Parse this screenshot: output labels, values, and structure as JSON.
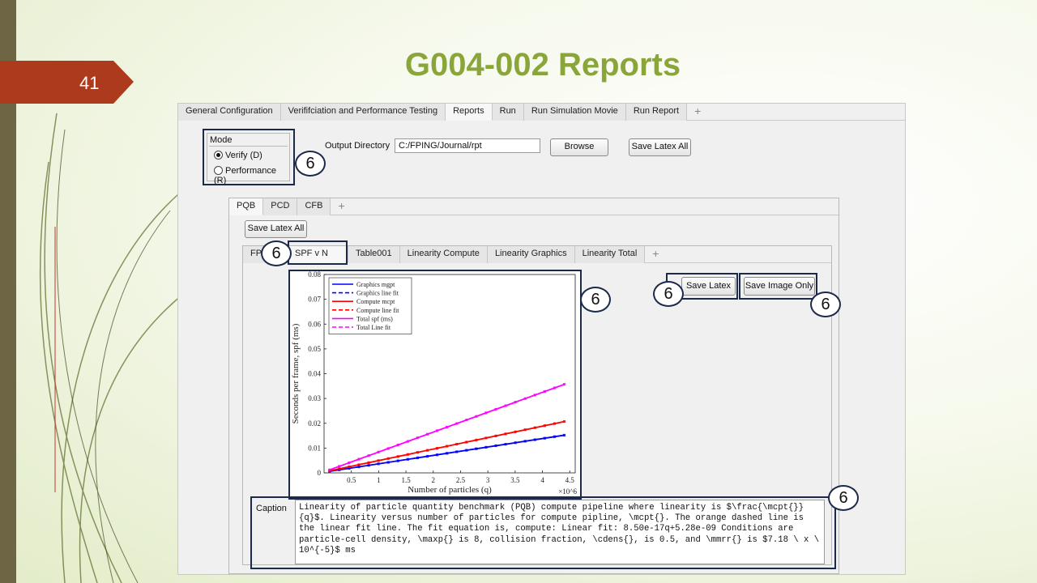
{
  "slide": {
    "number": "41",
    "title": "G004-002 Reports"
  },
  "main_tabs": [
    "General Configuration",
    "Verififciation and Performance Testing",
    "Reports",
    "Run",
    "Run Simulation Movie",
    "Run Report",
    "+"
  ],
  "mode": {
    "title": "Mode",
    "options": [
      "Verify (D)",
      "Performance (R)"
    ],
    "selected": 0
  },
  "output": {
    "label": "Output Directory",
    "value": "C:/FPING/Journal/rpt",
    "browse": "Browse",
    "save_all": "Save Latex All"
  },
  "sub_tabs": [
    "PQB",
    "PCD",
    "CFB",
    "+"
  ],
  "sub_save_all": "Save Latex All",
  "plot_tabs": [
    "FP",
    "SPF v N",
    "Table001",
    "Linearity Compute",
    "Linearity Graphics",
    "Linearity Total",
    "+"
  ],
  "save_latex": "Save Latex",
  "save_image_only": "Save Image Only",
  "callout_label": "6",
  "caption": {
    "label": "Caption",
    "text": "Linearity of particle quantity benchmark (PQB) compute pipeline where linearity is $\\frac{\\mcpt{}}{q}$. Linearity versus number of particles for compute pipline, \\mcpt{}. The orange dashed line is the linear fit line. The fit equation is, compute: Linear fit: 8.50e-17q+5.28e-09 Conditions are particle-cell density, \\maxp{} is 8, collision fraction, \\cdens{}, is 0.5, and \\mmrr{} is $7.18 \\ x \\ 10^{-5}$ ms"
  },
  "chart_data": {
    "type": "line",
    "xlabel": "Number of particles (q)",
    "ylabel": "Seconds per frame, spf (ms)",
    "x_multiplier": "×10^6",
    "x_ticks": [
      "0.5",
      "1",
      "1.5",
      "2",
      "2.5",
      "3",
      "3.5",
      "4",
      "4.5"
    ],
    "y_ticks": [
      "0",
      "0.01",
      "0.02",
      "0.03",
      "0.04",
      "0.05",
      "0.06",
      "0.07",
      "0.08"
    ],
    "xlim": [
      0,
      4.6
    ],
    "ylim": [
      0,
      0.08
    ],
    "legend_position": "top-left",
    "series": [
      {
        "name": "Graphics mgpt",
        "style": "solid",
        "color": "#0000ff",
        "x": [
          0.1,
          4.4
        ],
        "y": [
          0.0006,
          0.0152
        ]
      },
      {
        "name": "Graphics line fit",
        "style": "dashed",
        "color": "#0000ff",
        "x": [
          0.1,
          4.4
        ],
        "y": [
          0.0006,
          0.0152
        ]
      },
      {
        "name": "Compute mcpt",
        "style": "solid",
        "color": "#ff0000",
        "x": [
          0.1,
          4.4
        ],
        "y": [
          0.0008,
          0.0207
        ]
      },
      {
        "name": "Compute line fit",
        "style": "dashed",
        "color": "#ff0000",
        "x": [
          0.1,
          4.4
        ],
        "y": [
          0.0008,
          0.0207
        ]
      },
      {
        "name": "Total spf (ms)",
        "style": "solid",
        "color": "#ff00ff",
        "x": [
          0.1,
          4.4
        ],
        "y": [
          0.0012,
          0.0357
        ]
      },
      {
        "name": "Total Line fit",
        "style": "dashed",
        "color": "#ff00ff",
        "x": [
          0.1,
          4.4
        ],
        "y": [
          0.0012,
          0.0357
        ]
      }
    ]
  }
}
